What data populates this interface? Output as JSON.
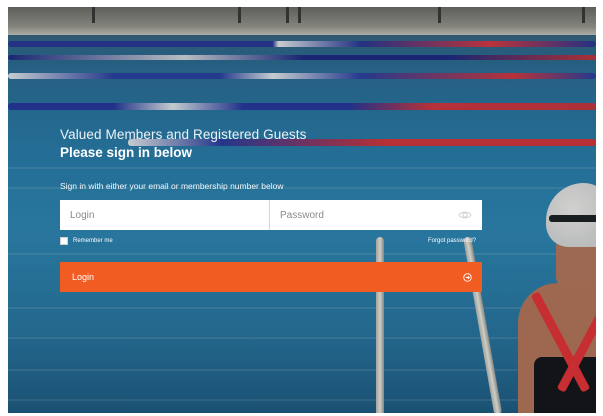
{
  "form": {
    "headline": "Valued Members and Registered Guests",
    "subheadline": "Please sign in below",
    "instruction": "Sign in with either your email or membership number below",
    "login_placeholder": "Login",
    "password_placeholder": "Password",
    "remember_label": "Remember me",
    "forgot_label": "Forgot password?",
    "submit_label": "Login"
  },
  "colors": {
    "button": "#f15c22",
    "input_bg": "#ffffff",
    "text": "#ffffff"
  },
  "icons": {
    "password_toggle": "eye-icon",
    "submit": "arrow-right-circle-icon"
  }
}
